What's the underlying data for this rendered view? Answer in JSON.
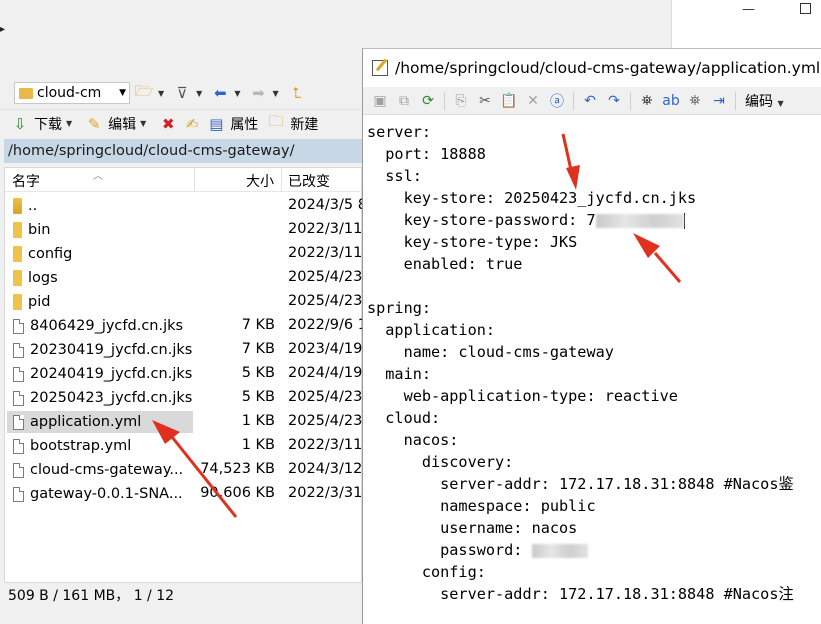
{
  "file_manager": {
    "location_combo": "cloud-cm",
    "toolbar": {
      "download_label": "下载",
      "edit_label": "编辑",
      "properties_label": "属性",
      "new_label": "新建"
    },
    "path": "/home/springcloud/cloud-cms-gateway/",
    "columns": {
      "name": "名字",
      "size": "大小",
      "modified": "已改变"
    },
    "files": [
      {
        "name": "..",
        "size": "",
        "date": "2024/3/5 8",
        "type": "up"
      },
      {
        "name": "bin",
        "size": "",
        "date": "2022/3/11",
        "type": "folder"
      },
      {
        "name": "config",
        "size": "",
        "date": "2022/3/11",
        "type": "folder"
      },
      {
        "name": "logs",
        "size": "",
        "date": "2025/4/23",
        "type": "folder"
      },
      {
        "name": "pid",
        "size": "",
        "date": "2025/4/23",
        "type": "folder"
      },
      {
        "name": "8406429_jycfd.cn.jks",
        "size": "7 KB",
        "date": "2022/9/6 1",
        "type": "file"
      },
      {
        "name": "20230419_jycfd.cn.jks",
        "size": "7 KB",
        "date": "2023/4/19",
        "type": "file"
      },
      {
        "name": "20240419_jycfd.cn.jks",
        "size": "5 KB",
        "date": "2024/4/19",
        "type": "file"
      },
      {
        "name": "20250423_jycfd.cn.jks",
        "size": "5 KB",
        "date": "2025/4/23",
        "type": "file"
      },
      {
        "name": "application.yml",
        "size": "1 KB",
        "date": "2025/4/23",
        "type": "file",
        "selected": true
      },
      {
        "name": "bootstrap.yml",
        "size": "1 KB",
        "date": "2022/3/11",
        "type": "file"
      },
      {
        "name": "cloud-cms-gateway...",
        "size": "74,523 KB",
        "date": "2024/3/12",
        "type": "file"
      },
      {
        "name": "gateway-0.0.1-SNA...",
        "size": "90,606 KB",
        "date": "2022/3/31",
        "type": "file"
      }
    ],
    "status": "509 B / 161 MB，  1 / 12"
  },
  "editor": {
    "title": "/home/springcloud/cloud-cms-gateway/application.yml - r",
    "encoding_label": "编码",
    "code_lines": [
      "server:",
      "  port: 18888",
      "  ssl:",
      "    key-store: 20250423_jycfd.cn.jks",
      "    key-store-password: 7",
      "    key-store-type: JKS",
      "    enabled: true",
      "",
      "spring:",
      "  application:",
      "    name: cloud-cms-gateway",
      "  main:",
      "    web-application-type: reactive",
      "  cloud:",
      "    nacos:",
      "      discovery:",
      "        server-addr: 172.17.18.31:8848 #Nacos鉴",
      "        namespace: public",
      "        username: nacos",
      "        password: ",
      "      config:",
      "        server-addr: 172.17.18.31:8848 #Nacos注"
    ]
  },
  "colors": {
    "path_bar": "#c8d7e6",
    "selection": "#d9d9d9",
    "annotation_arrow": "#e0301e"
  }
}
